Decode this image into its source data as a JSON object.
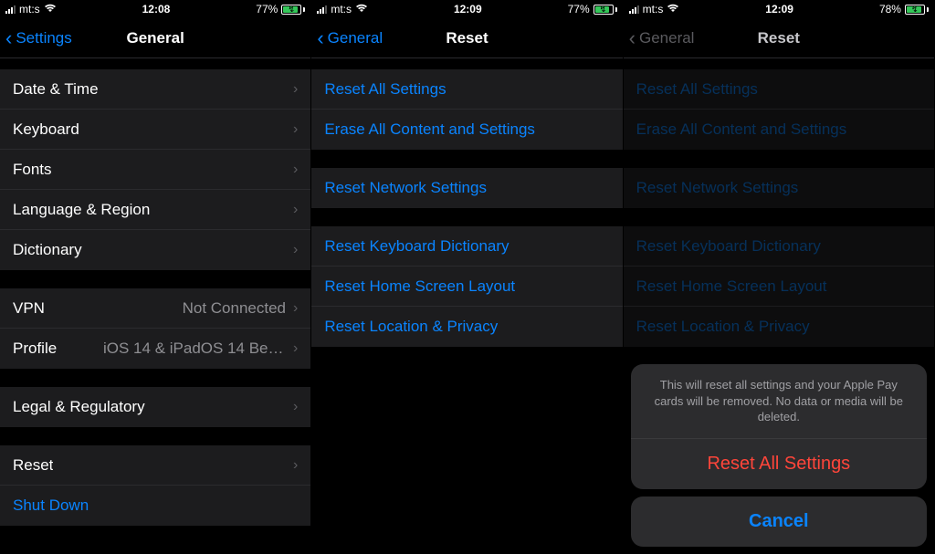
{
  "colors": {
    "accent": "#0a84ff",
    "destructive": "#ff453a",
    "batteryFill": "#34c759"
  },
  "screens": [
    {
      "status": {
        "carrier": "mt:s",
        "time": "12:08",
        "batteryPct": "77%",
        "batteryLevel": 77
      },
      "nav": {
        "back": "Settings",
        "title": "General"
      },
      "groups": [
        {
          "rows": [
            {
              "label": "Date & Time",
              "chevron": true
            },
            {
              "label": "Keyboard",
              "chevron": true
            },
            {
              "label": "Fonts",
              "chevron": true
            },
            {
              "label": "Language & Region",
              "chevron": true
            },
            {
              "label": "Dictionary",
              "chevron": true
            }
          ]
        },
        {
          "rows": [
            {
              "label": "VPN",
              "detail": "Not Connected",
              "chevron": true
            },
            {
              "label": "Profile",
              "detail": "iOS 14 & iPadOS 14 Beta Softwar...",
              "chevron": true
            }
          ]
        },
        {
          "rows": [
            {
              "label": "Legal & Regulatory",
              "chevron": true
            }
          ]
        },
        {
          "rows": [
            {
              "label": "Reset",
              "chevron": true
            },
            {
              "label": "Shut Down",
              "link": true
            }
          ]
        }
      ]
    },
    {
      "status": {
        "carrier": "mt:s",
        "time": "12:09",
        "batteryPct": "77%",
        "batteryLevel": 77
      },
      "nav": {
        "back": "General",
        "title": "Reset"
      },
      "groups": [
        {
          "rows": [
            {
              "label": "Reset All Settings",
              "link": true
            },
            {
              "label": "Erase All Content and Settings",
              "link": true
            }
          ]
        },
        {
          "rows": [
            {
              "label": "Reset Network Settings",
              "link": true
            }
          ]
        },
        {
          "rows": [
            {
              "label": "Reset Keyboard Dictionary",
              "link": true
            },
            {
              "label": "Reset Home Screen Layout",
              "link": true
            },
            {
              "label": "Reset Location & Privacy",
              "link": true
            }
          ]
        }
      ]
    },
    {
      "status": {
        "carrier": "mt:s",
        "time": "12:09",
        "batteryPct": "78%",
        "batteryLevel": 78
      },
      "nav": {
        "back": "General",
        "title": "Reset"
      },
      "faded": true,
      "groups": [
        {
          "rows": [
            {
              "label": "Reset All Settings",
              "link": true
            },
            {
              "label": "Erase All Content and Settings",
              "link": true
            }
          ]
        },
        {
          "rows": [
            {
              "label": "Reset Network Settings",
              "link": true
            }
          ]
        },
        {
          "rows": [
            {
              "label": "Reset Keyboard Dictionary",
              "link": true
            },
            {
              "label": "Reset Home Screen Layout",
              "link": true
            },
            {
              "label": "Reset Location & Privacy",
              "link": true
            }
          ]
        }
      ],
      "sheet": {
        "message": "This will reset all settings and your Apple Pay cards will be removed. No data or media will be deleted.",
        "action": "Reset All Settings",
        "cancel": "Cancel"
      }
    }
  ]
}
